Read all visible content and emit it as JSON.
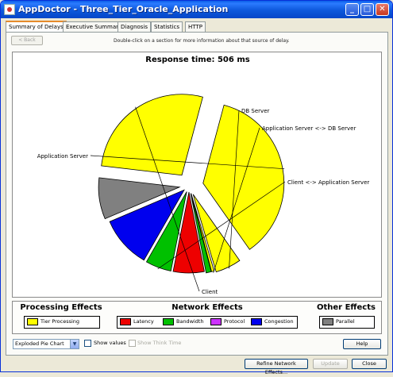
{
  "window": {
    "title": "AppDoctor - Three_Tier_Oracle_Application"
  },
  "tabs": [
    {
      "label": "Summary of Delays",
      "active": true
    },
    {
      "label": "Executive Summary",
      "active": false
    },
    {
      "label": "Diagnosis",
      "active": false
    },
    {
      "label": "Statistics",
      "active": false
    },
    {
      "label": "HTTP",
      "active": false
    }
  ],
  "toolbar": {
    "back_label": "< Back",
    "hint": "Double-click on a section for more information about that source of delay."
  },
  "chart_data": {
    "type": "pie",
    "title": "Response time: 506 ms",
    "slices": [
      {
        "label": "Application Server",
        "value": 35,
        "color": "#ffff00"
      },
      {
        "label": "DB Server",
        "value": 5,
        "color": "#ffff00"
      },
      {
        "label": "Application Server <-> DB Server (Tier Processing)",
        "value": 0.5,
        "color": "#ffff00"
      },
      {
        "label": "Application Server <-> DB Server (Bandwidth)",
        "value": 1,
        "color": "#00c000"
      },
      {
        "label": "Client <-> Application Server (Latency)",
        "value": 6,
        "color": "#ee0000"
      },
      {
        "label": "Client <-> Application Server (Bandwidth)",
        "value": 5,
        "color": "#00c000"
      },
      {
        "label": "Client <-> Application Server (Congestion)",
        "value": 10,
        "color": "#0000ee"
      },
      {
        "label": "Parallel",
        "value": 8,
        "color": "#808080"
      },
      {
        "label": "Client",
        "value": 26.5,
        "color": "#ffff00"
      }
    ],
    "callouts": [
      "Application Server",
      "DB Server",
      "Application Server <-> DB Server",
      "Client <-> Application Server",
      "Client"
    ]
  },
  "legend": {
    "processing": {
      "title": "Processing Effects",
      "items": [
        {
          "label": "Tier Processing",
          "color": "#ffff00"
        }
      ]
    },
    "network": {
      "title": "Network Effects",
      "items": [
        {
          "label": "Latency",
          "color": "#ee0000"
        },
        {
          "label": "Bandwidth",
          "color": "#00c000"
        },
        {
          "label": "Protocol",
          "color": "#cc33ff"
        },
        {
          "label": "Congestion",
          "color": "#0000ee"
        }
      ]
    },
    "other": {
      "title": "Other Effects",
      "items": [
        {
          "label": "Parallel",
          "color": "#808080"
        }
      ]
    }
  },
  "controls": {
    "chart_type": "Exploded Pie Chart",
    "show_values": "Show values",
    "show_think_time": "Show Think Time",
    "help": "Help"
  },
  "footer": {
    "refine": "Refine Network Effects...",
    "update": "Update",
    "close": "Close"
  }
}
